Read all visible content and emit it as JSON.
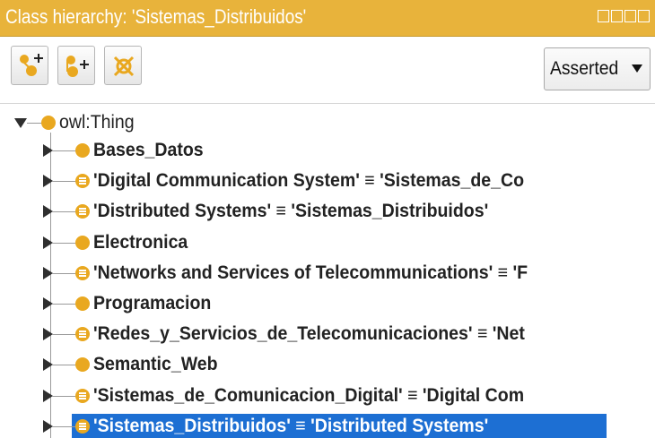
{
  "window": {
    "title": "Class hierarchy: 'Sistemas_Distribuidos'"
  },
  "toolbar": {
    "add_subclass_icon": "add-subclass-icon",
    "add_sibling_icon": "add-sibling-class-icon",
    "delete_icon": "delete-class-icon",
    "view_mode_selected": "Asserted"
  },
  "colors": {
    "titlebar": "#e8b33b",
    "class_node": "#e9a820",
    "selection": "#1d6fd3"
  },
  "tree": {
    "root": {
      "label": "owl:Thing",
      "expanded": true
    },
    "children": [
      {
        "label": "Bases_Datos",
        "equivalent": false
      },
      {
        "label": "'Digital Communication System' ≡ 'Sistemas_de_Co",
        "equivalent": true
      },
      {
        "label": "'Distributed Systems' ≡ 'Sistemas_Distribuidos'",
        "equivalent": true
      },
      {
        "label": "Electronica",
        "equivalent": false
      },
      {
        "label": "'Networks and Services of Telecommunications' ≡ 'F",
        "equivalent": true
      },
      {
        "label": "Programacion",
        "equivalent": false
      },
      {
        "label": "'Redes_y_Servicios_de_Telecomunicaciones' ≡ 'Net",
        "equivalent": true
      },
      {
        "label": "Semantic_Web",
        "equivalent": false
      },
      {
        "label": "'Sistemas_de_Comunicacion_Digital' ≡ 'Digital Com",
        "equivalent": true
      },
      {
        "label": "'Sistemas_Distribuidos' ≡ 'Distributed Systems'",
        "equivalent": true,
        "selected": true
      }
    ]
  }
}
